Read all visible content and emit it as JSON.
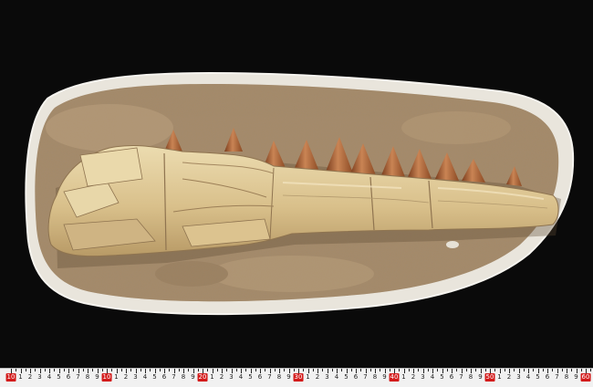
{
  "photo": {
    "subject": "Mosasaur jaw fossil with teeth in sandstone matrix on plaster base",
    "colors": {
      "background": "#0a0a0a",
      "plaster": "#e9e5dc",
      "matrix": "#a58a68",
      "bone": "#ddc592",
      "tooth": "#b06a3f"
    }
  },
  "ruler": {
    "labels": [
      "1",
      "2",
      "3",
      "4",
      "5",
      "6",
      "7",
      "8",
      "9",
      "10",
      "1",
      "2",
      "3",
      "4",
      "5",
      "6",
      "7",
      "8",
      "9",
      "20",
      "1",
      "2",
      "3",
      "4",
      "5",
      "6",
      "7",
      "8",
      "9",
      "30",
      "1",
      "2",
      "3",
      "4",
      "5",
      "6",
      "7",
      "8",
      "9",
      "40",
      "1",
      "2",
      "3",
      "4",
      "5",
      "6",
      "7",
      "8",
      "9",
      "50",
      "1",
      "2",
      "3",
      "4",
      "5",
      "6",
      "7",
      "8",
      "9",
      "60"
    ],
    "start_label": "10",
    "highlight_color": "#d31a1a"
  }
}
